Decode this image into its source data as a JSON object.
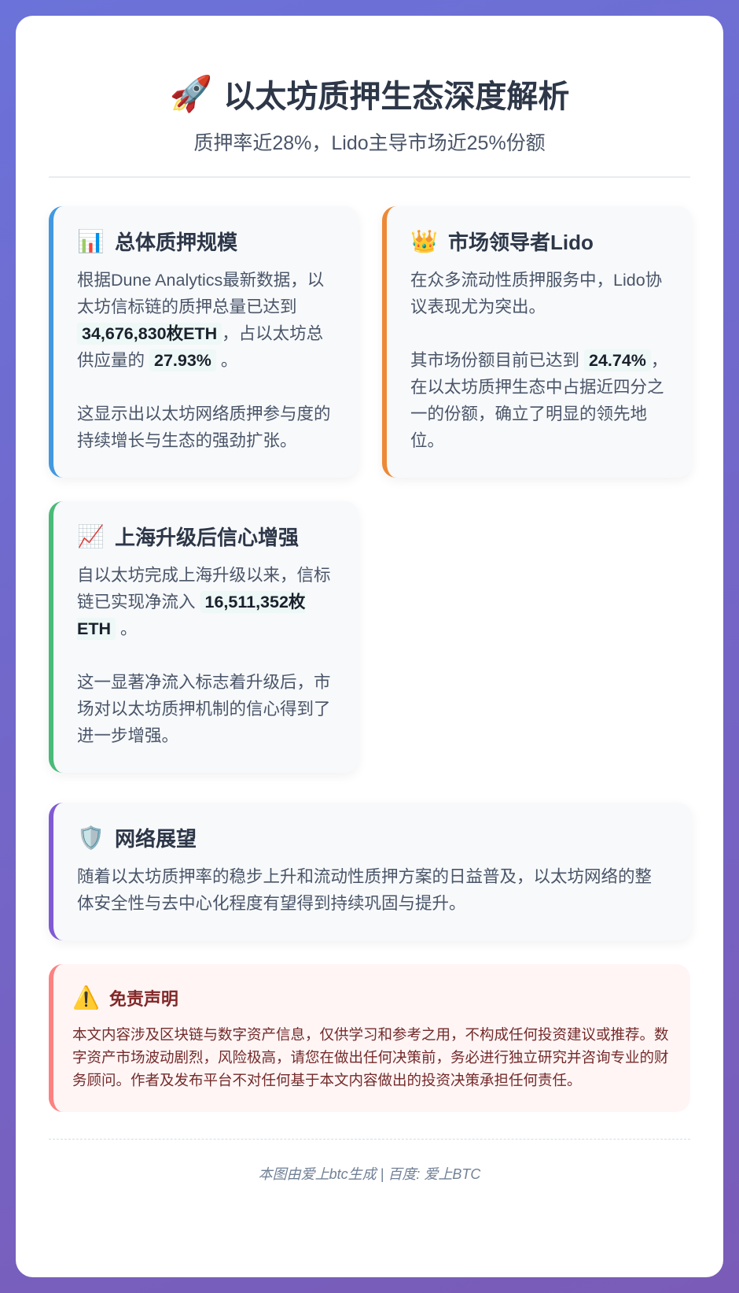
{
  "header": {
    "title_icon": "rocket-icon",
    "title_emoji": "🚀",
    "title": "以太坊质押生态深度解析",
    "subtitle": "质押率近28%，Lido主导市场近25%份额"
  },
  "sections": {
    "scale": {
      "icon": "bar-chart-icon",
      "emoji": "📊",
      "accent": "#4299e1",
      "title": "总体质押规模",
      "p1_a": "根据Dune Analytics最新数据，以太坊信标链的质押总量已达到",
      "p1_hl1": "34,676,830枚ETH",
      "p1_b": "，占以太坊总供应量的",
      "p1_hl2": "27.93%",
      "p1_c": "。",
      "p2": "这显示出以太坊网络质押参与度的持续增长与生态的强劲扩张。"
    },
    "lido": {
      "icon": "crown-icon",
      "emoji": "👑",
      "accent": "#ed8936",
      "title": "市场领导者Lido",
      "p1": "在众多流动性质押服务中，Lido协议表现尤为突出。",
      "p2_a": "其市场份额目前已达到",
      "p2_hl": "24.74%",
      "p2_b": "，在以太坊质押生态中占据近四分之一的份额，确立了明显的领先地位。"
    },
    "shanghai": {
      "icon": "trending-up-icon",
      "emoji": "📈",
      "accent": "#48bb78",
      "title": "上海升级后信心增强",
      "p1_a": "自以太坊完成上海升级以来，信标链已实现净流入",
      "p1_hl": "16,511,352枚ETH",
      "p1_b": "。",
      "p2": "这一显著净流入标志着升级后，市场对以太坊质押机制的信心得到了进一步增强。"
    },
    "outlook": {
      "icon": "shield-icon",
      "emoji": "🛡️",
      "accent": "#805ad5",
      "title": "网络展望",
      "body": "随着以太坊质押率的稳步上升和流动性质押方案的日益普及，以太坊网络的整体安全性与去中心化程度有望得到持续巩固与提升。"
    }
  },
  "disclaimer": {
    "icon": "warning-icon",
    "emoji": "⚠️",
    "title": "免责声明",
    "body": "本文内容涉及区块链与数字资产信息，仅供学习和参考之用，不构成任何投资建议或推荐。数字资产市场波动剧烈，风险极高，请您在做出任何决策前，务必进行独立研究并咨询专业的财务顾问。作者及发布平台不对任何基于本文内容做出的投资决策承担任何责任。"
  },
  "footer": {
    "text": "本图由爱上btc生成 | 百度: 爱上BTC"
  }
}
